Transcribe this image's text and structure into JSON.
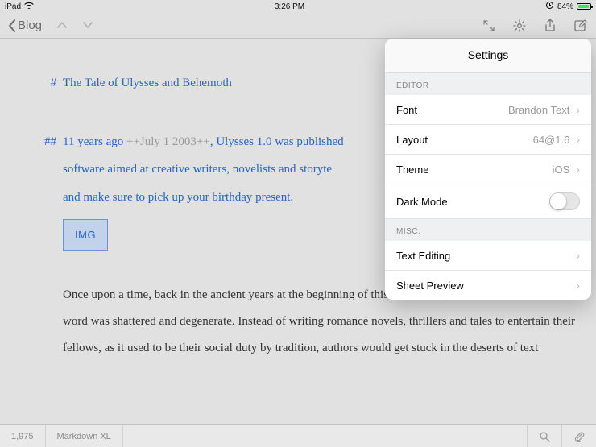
{
  "status": {
    "device": "iPad",
    "time": "3:26 PM",
    "battery_pct": "84%"
  },
  "toolbar": {
    "back_label": "Blog"
  },
  "editor": {
    "h1_marker": "#",
    "h1_text": "The Tale of Ulysses and Behemoth",
    "h2_marker": "##",
    "line2_blue_a": "11 years ago",
    "line2_grey": "++July 1 2003++",
    "line2_blue_b": ",  Ulysses 1.0 was published",
    "line3": "software aimed at creative writers, novelists and storyte",
    "line4": "and make sure to pick up your birthday present.",
    "img_pill": "IMG",
    "body": "Once upon a time, back in the ancient years at the beginning of this millennium, the world of the written word was shattered and degenerate. Instead of writing romance novels, thrillers and tales to entertain their fellows, as it used to be their social duty by tradition, authors would get stuck in the deserts of text"
  },
  "bottom": {
    "word_count": "1,975",
    "syntax": "Markdown XL"
  },
  "settings": {
    "title": "Settings",
    "section_editor": "EDITOR",
    "font_label": "Font",
    "font_value": "Brandon Text",
    "layout_label": "Layout",
    "layout_value": "64@1.6",
    "theme_label": "Theme",
    "theme_value": "iOS",
    "dark_mode_label": "Dark Mode",
    "section_misc": "MISC.",
    "text_editing_label": "Text Editing",
    "sheet_preview_label": "Sheet Preview"
  }
}
